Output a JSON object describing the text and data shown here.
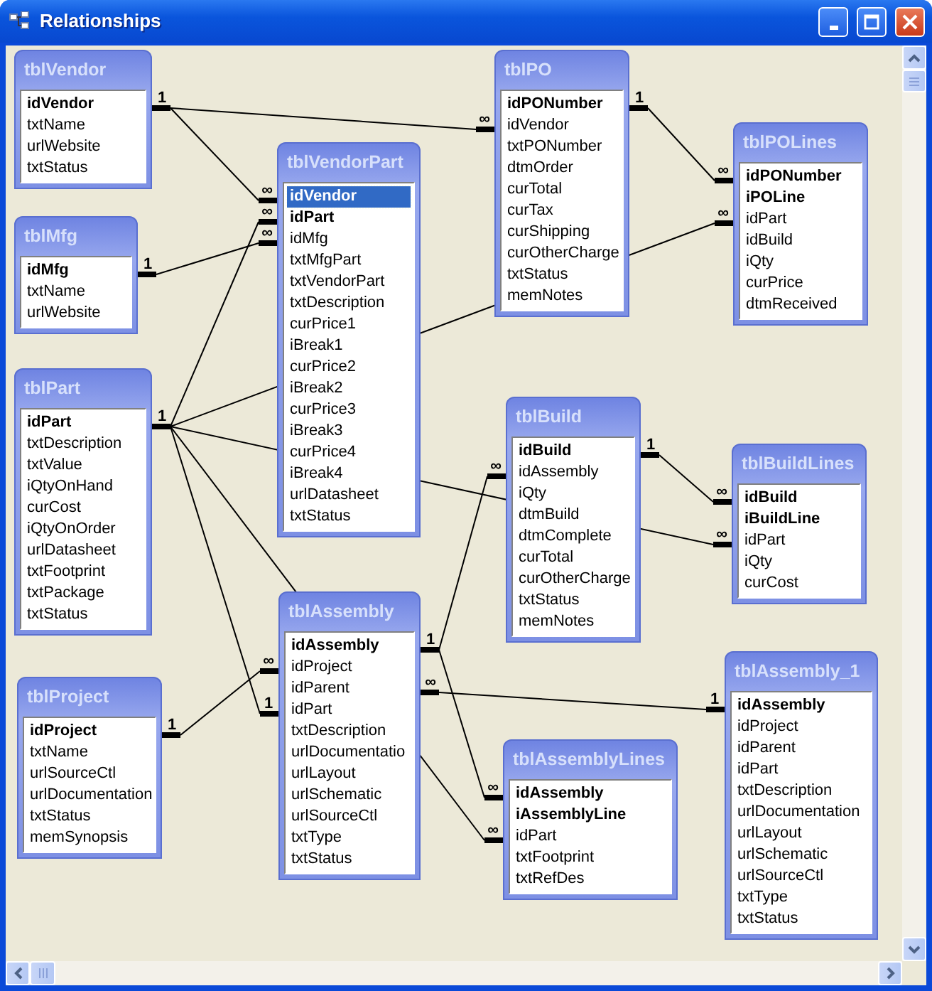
{
  "window": {
    "title": "Relationships"
  },
  "tables": [
    {
      "name": "tblVendor",
      "fields": [
        {
          "name": "idVendor",
          "key": true,
          "selected": false
        },
        {
          "name": "txtName",
          "key": false,
          "selected": false
        },
        {
          "name": "urlWebsite",
          "key": false,
          "selected": false
        },
        {
          "name": "txtStatus",
          "key": false,
          "selected": false
        }
      ]
    },
    {
      "name": "tblMfg",
      "fields": [
        {
          "name": "idMfg",
          "key": true,
          "selected": false
        },
        {
          "name": "txtName",
          "key": false,
          "selected": false
        },
        {
          "name": "urlWebsite",
          "key": false,
          "selected": false
        }
      ]
    },
    {
      "name": "tblPart",
      "fields": [
        {
          "name": "idPart",
          "key": true,
          "selected": false
        },
        {
          "name": "txtDescription",
          "key": false,
          "selected": false
        },
        {
          "name": "txtValue",
          "key": false,
          "selected": false
        },
        {
          "name": "iQtyOnHand",
          "key": false,
          "selected": false
        },
        {
          "name": "curCost",
          "key": false,
          "selected": false
        },
        {
          "name": "iQtyOnOrder",
          "key": false,
          "selected": false
        },
        {
          "name": "urlDatasheet",
          "key": false,
          "selected": false
        },
        {
          "name": "txtFootprint",
          "key": false,
          "selected": false
        },
        {
          "name": "txtPackage",
          "key": false,
          "selected": false
        },
        {
          "name": "txtStatus",
          "key": false,
          "selected": false
        }
      ]
    },
    {
      "name": "tblProject",
      "fields": [
        {
          "name": "idProject",
          "key": true,
          "selected": false
        },
        {
          "name": "txtName",
          "key": false,
          "selected": false
        },
        {
          "name": "urlSourceCtl",
          "key": false,
          "selected": false
        },
        {
          "name": "urlDocumentation",
          "key": false,
          "selected": false
        },
        {
          "name": "txtStatus",
          "key": false,
          "selected": false
        },
        {
          "name": "memSynopsis",
          "key": false,
          "selected": false
        }
      ]
    },
    {
      "name": "tblVendorPart",
      "fields": [
        {
          "name": "idVendor",
          "key": true,
          "selected": true
        },
        {
          "name": "idPart",
          "key": true,
          "selected": false
        },
        {
          "name": "idMfg",
          "key": false,
          "selected": false
        },
        {
          "name": "txtMfgPart",
          "key": false,
          "selected": false
        },
        {
          "name": "txtVendorPart",
          "key": false,
          "selected": false
        },
        {
          "name": "txtDescription",
          "key": false,
          "selected": false
        },
        {
          "name": "curPrice1",
          "key": false,
          "selected": false
        },
        {
          "name": "iBreak1",
          "key": false,
          "selected": false
        },
        {
          "name": "curPrice2",
          "key": false,
          "selected": false
        },
        {
          "name": "iBreak2",
          "key": false,
          "selected": false
        },
        {
          "name": "curPrice3",
          "key": false,
          "selected": false
        },
        {
          "name": "iBreak3",
          "key": false,
          "selected": false
        },
        {
          "name": "curPrice4",
          "key": false,
          "selected": false
        },
        {
          "name": "iBreak4",
          "key": false,
          "selected": false
        },
        {
          "name": "urlDatasheet",
          "key": false,
          "selected": false
        },
        {
          "name": "txtStatus",
          "key": false,
          "selected": false
        }
      ]
    },
    {
      "name": "tblPO",
      "fields": [
        {
          "name": "idPONumber",
          "key": true,
          "selected": false
        },
        {
          "name": "idVendor",
          "key": false,
          "selected": false
        },
        {
          "name": "txtPONumber",
          "key": false,
          "selected": false
        },
        {
          "name": "dtmOrder",
          "key": false,
          "selected": false
        },
        {
          "name": "curTotal",
          "key": false,
          "selected": false
        },
        {
          "name": "curTax",
          "key": false,
          "selected": false
        },
        {
          "name": "curShipping",
          "key": false,
          "selected": false
        },
        {
          "name": "curOtherCharge",
          "key": false,
          "selected": false
        },
        {
          "name": "txtStatus",
          "key": false,
          "selected": false
        },
        {
          "name": "memNotes",
          "key": false,
          "selected": false
        }
      ]
    },
    {
      "name": "tblPOLines",
      "fields": [
        {
          "name": "idPONumber",
          "key": true,
          "selected": false
        },
        {
          "name": "iPOLine",
          "key": true,
          "selected": false
        },
        {
          "name": "idPart",
          "key": false,
          "selected": false
        },
        {
          "name": "idBuild",
          "key": false,
          "selected": false
        },
        {
          "name": "iQty",
          "key": false,
          "selected": false
        },
        {
          "name": "curPrice",
          "key": false,
          "selected": false
        },
        {
          "name": "dtmReceived",
          "key": false,
          "selected": false
        }
      ]
    },
    {
      "name": "tblBuild",
      "fields": [
        {
          "name": "idBuild",
          "key": true,
          "selected": false
        },
        {
          "name": "idAssembly",
          "key": false,
          "selected": false
        },
        {
          "name": "iQty",
          "key": false,
          "selected": false
        },
        {
          "name": "dtmBuild",
          "key": false,
          "selected": false
        },
        {
          "name": "dtmComplete",
          "key": false,
          "selected": false
        },
        {
          "name": "curTotal",
          "key": false,
          "selected": false
        },
        {
          "name": "curOtherCharge",
          "key": false,
          "selected": false
        },
        {
          "name": "txtStatus",
          "key": false,
          "selected": false
        },
        {
          "name": "memNotes",
          "key": false,
          "selected": false
        }
      ]
    },
    {
      "name": "tblBuildLines",
      "fields": [
        {
          "name": "idBuild",
          "key": true,
          "selected": false
        },
        {
          "name": "iBuildLine",
          "key": true,
          "selected": false
        },
        {
          "name": "idPart",
          "key": false,
          "selected": false
        },
        {
          "name": "iQty",
          "key": false,
          "selected": false
        },
        {
          "name": "curCost",
          "key": false,
          "selected": false
        }
      ]
    },
    {
      "name": "tblAssembly",
      "fields": [
        {
          "name": "idAssembly",
          "key": true,
          "selected": false
        },
        {
          "name": "idProject",
          "key": false,
          "selected": false
        },
        {
          "name": "idParent",
          "key": false,
          "selected": false
        },
        {
          "name": "idPart",
          "key": false,
          "selected": false
        },
        {
          "name": "txtDescription",
          "key": false,
          "selected": false
        },
        {
          "name": "urlDocumentatio",
          "key": false,
          "selected": false
        },
        {
          "name": "urlLayout",
          "key": false,
          "selected": false
        },
        {
          "name": "urlSchematic",
          "key": false,
          "selected": false
        },
        {
          "name": "urlSourceCtl",
          "key": false,
          "selected": false
        },
        {
          "name": "txtType",
          "key": false,
          "selected": false
        },
        {
          "name": "txtStatus",
          "key": false,
          "selected": false
        }
      ]
    },
    {
      "name": "tblAssemblyLines",
      "fields": [
        {
          "name": "idAssembly",
          "key": true,
          "selected": false
        },
        {
          "name": "iAssemblyLine",
          "key": true,
          "selected": false
        },
        {
          "name": "idPart",
          "key": false,
          "selected": false
        },
        {
          "name": "txtFootprint",
          "key": false,
          "selected": false
        },
        {
          "name": "txtRefDes",
          "key": false,
          "selected": false
        }
      ]
    },
    {
      "name": "tblAssembly_1",
      "fields": [
        {
          "name": "idAssembly",
          "key": true,
          "selected": false
        },
        {
          "name": "idProject",
          "key": false,
          "selected": false
        },
        {
          "name": "idParent",
          "key": false,
          "selected": false
        },
        {
          "name": "idPart",
          "key": false,
          "selected": false
        },
        {
          "name": "txtDescription",
          "key": false,
          "selected": false
        },
        {
          "name": "urlDocumentation",
          "key": false,
          "selected": false
        },
        {
          "name": "urlLayout",
          "key": false,
          "selected": false
        },
        {
          "name": "urlSchematic",
          "key": false,
          "selected": false
        },
        {
          "name": "urlSourceCtl",
          "key": false,
          "selected": false
        },
        {
          "name": "txtType",
          "key": false,
          "selected": false
        },
        {
          "name": "txtStatus",
          "key": false,
          "selected": false
        }
      ]
    }
  ],
  "relationships": [
    {
      "start_label": "1",
      "end_label": "∞"
    },
    {
      "end_label": "∞"
    },
    {
      "start_label": "1",
      "end_label": "∞"
    },
    {
      "start_label": "1",
      "end_label": "∞"
    },
    {
      "start_label": "1",
      "end_label": "∞"
    },
    {
      "end_label": "∞"
    },
    {
      "start_label": "1",
      "end_label": "∞"
    },
    {
      "end_label": "∞"
    },
    {
      "start_label": "1",
      "end_label": "∞"
    },
    {
      "end_label": "1"
    },
    {
      "start_label": "1",
      "end_label": "∞"
    },
    {
      "end_label": "∞"
    },
    {
      "end_label": "∞"
    },
    {
      "start_label": "∞",
      "end_label": "1"
    }
  ]
}
